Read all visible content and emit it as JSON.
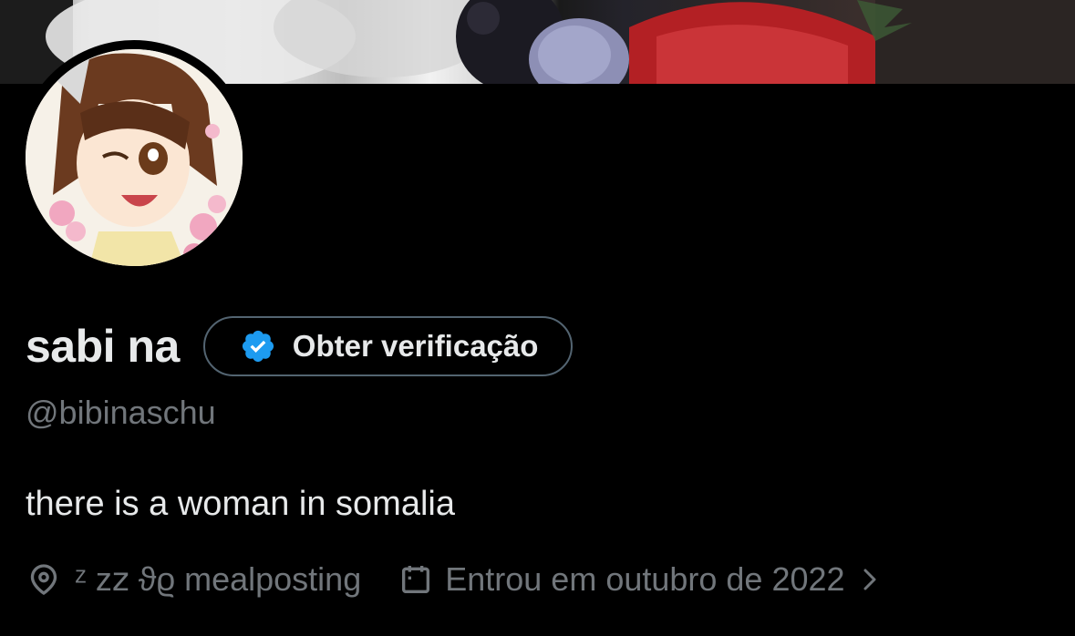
{
  "profile": {
    "display_name": "sabi na",
    "handle": "@bibinaschu",
    "bio": "there is a woman in somalia",
    "location": "ᶻ z𝗓 ϑϱ mealposting",
    "joined": "Entrou em outubro de 2022"
  },
  "verification": {
    "label": "Obter verificação"
  },
  "icons": {
    "verify": "verified-badge-icon",
    "location": "location-pin-icon",
    "calendar": "calendar-icon",
    "chevron": "chevron-right-icon"
  },
  "colors": {
    "background": "#000000",
    "text_primary": "#e7e9ea",
    "text_secondary": "#71767b",
    "button_border": "#536471",
    "verified_blue": "#1d9bf0"
  }
}
